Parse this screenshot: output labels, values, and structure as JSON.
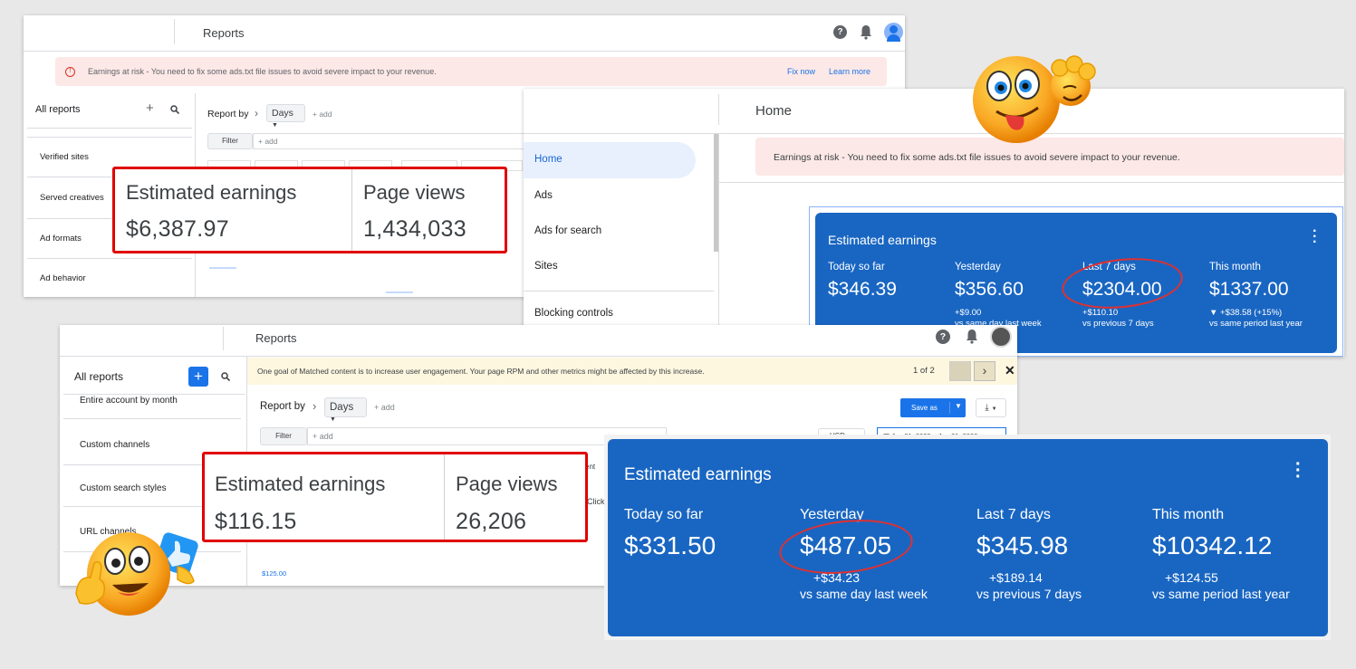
{
  "panel1": {
    "title": "Reports",
    "alert": "Earnings at risk - You need to fix some ads.txt file issues to avoid severe impact to your revenue.",
    "fix_now": "Fix now",
    "learn_more": "Learn more",
    "all_reports": "All reports",
    "report_by": "Report by",
    "days": "Days",
    "add": "+ add",
    "filter": "Filter",
    "filter_add": "+ add",
    "sidebar": [
      "Verified sites",
      "Served creatives",
      "Ad formats",
      "Ad behavior"
    ],
    "metrics": [
      {
        "label": "Estimated earnings",
        "value": "$6,387.97"
      },
      {
        "label": "Page views",
        "value": "1,434,033"
      }
    ]
  },
  "panel2": {
    "title": "Home",
    "alert": "Earnings at risk - You need to fix some ads.txt file issues to avoid severe impact to your revenue.",
    "nav": [
      "Home",
      "Ads",
      "Ads for search",
      "Sites",
      "Blocking controls"
    ],
    "card": {
      "title": "Estimated earnings",
      "stats": [
        {
          "label": "Today so far",
          "value": "$346.39",
          "delta": "",
          "compare": ""
        },
        {
          "label": "Yesterday",
          "value": "$356.60",
          "delta": "+$9.00",
          "compare": "vs same day last week"
        },
        {
          "label": "Last 7 days",
          "value": "$2304.00",
          "delta": "+$110.10",
          "compare": "vs previous 7 days"
        },
        {
          "label": "This month",
          "value": "$1337.00",
          "delta": "▼ +$38.58 (+15%)",
          "compare": "vs same period last year"
        }
      ]
    }
  },
  "panel3": {
    "title": "Reports",
    "all_reports": "All reports",
    "banner": "One goal of Matched content is to increase user engagement. Your page RPM and other metrics might be affected by this increase.",
    "pager": "1 of 2",
    "report_by": "Report by",
    "days": "Days",
    "add": "+ add",
    "save_as": "Save as",
    "filter": "Filter",
    "filter_add": "+ add",
    "currency": "USD",
    "date_range": "Jun 21, 2020 – Jun 21, 2020",
    "chart_tick": "$125.00",
    "sidebar": [
      "Entire account by month",
      "Custom channels",
      "Custom search styles",
      "URL channels"
    ],
    "metrics": [
      {
        "label": "Estimated earnings",
        "value": "$116.15"
      },
      {
        "label": "Page views",
        "value": "26,206"
      }
    ],
    "behind_text": [
      "ent",
      "Click"
    ]
  },
  "card4": {
    "title": "Estimated earnings",
    "stats": [
      {
        "label": "Today so far",
        "value": "$331.50",
        "delta": "",
        "compare": ""
      },
      {
        "label": "Yesterday",
        "value": "$487.05",
        "delta": "+$34.23",
        "compare": "vs same day last week"
      },
      {
        "label": "Last 7 days",
        "value": "$345.98",
        "delta": "+$189.14",
        "compare": "vs previous 7 days"
      },
      {
        "label": "This month",
        "value": "$10342.12",
        "delta": "+$124.55",
        "compare": "vs same period last year"
      }
    ]
  },
  "colors": {
    "card_blue": "#1966c2",
    "alert_red": "#fce8e6",
    "banner_yellow": "#fef7e0",
    "highlight_red": "#e00000",
    "nav_active": "#e8f0fe"
  }
}
